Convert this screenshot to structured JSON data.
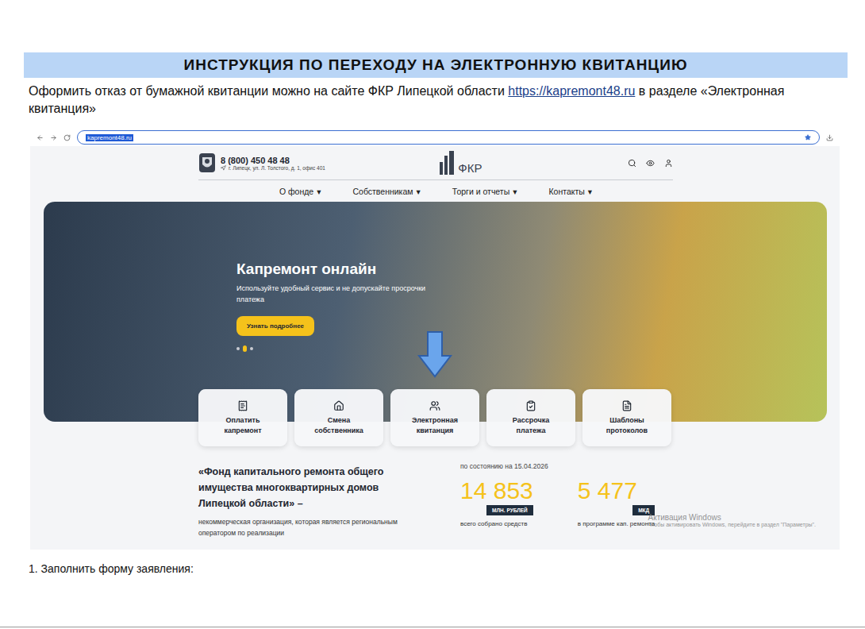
{
  "document": {
    "title": "ИНСТРУКЦИЯ ПО ПЕРЕХОДУ НА ЭЛЕКТРОННУЮ КВИТАНЦИЮ",
    "intro_before": "Оформить отказ от бумажной квитанции можно на сайте ФКР Липецкой области ",
    "intro_link": "https://kapremont48.ru",
    "intro_after": " в разделе «Электронная квитанция»",
    "step": "1. Заполнить форму заявления:"
  },
  "browser": {
    "url": "kapremont48.ru"
  },
  "site": {
    "phone": "8 (800) 450 48 48",
    "address": "г. Липецк, ул. Л. Толстого, д. 1, офис 401",
    "logo": "ФКР",
    "nav": [
      {
        "label": "О фонде",
        "symbol": "▾"
      },
      {
        "label": "Собственникам",
        "symbol": "▾"
      },
      {
        "label": "Торги и отчеты",
        "symbol": "▾"
      },
      {
        "label": "Контакты",
        "symbol": "▾"
      }
    ]
  },
  "hero": {
    "title": "Капремонт онлайн",
    "subtitle": "Используйте удобный сервис и не допускайте просрочки платежа",
    "button": "Узнать подробнее",
    "slides": [
      {
        "selected": false
      },
      {
        "selected": true
      },
      {
        "selected": false
      }
    ]
  },
  "cards": [
    {
      "label": "Оплатить капремонт",
      "pointed": false
    },
    {
      "label": "Смена собственника",
      "pointed": false
    },
    {
      "label": "Электронная квитанция",
      "pointed": true
    },
    {
      "label": "Рассрочка платежа",
      "pointed": false
    },
    {
      "label": "Шаблоны протоколов",
      "pointed": false
    }
  ],
  "about": {
    "title": "«Фонд капитального ремонта общего имущества многоквартирных домов Липецкой области» –",
    "text": "некоммерческая организация, которая является региональным оператором по реализации"
  },
  "stats": {
    "date": "по состоянию на 15.04.2026",
    "items": [
      {
        "value": "14 853",
        "unit": "МЛН. РУБЛЕЙ",
        "caption": "всего собрано средств"
      },
      {
        "value": "5 477",
        "unit": "МКД",
        "caption": "в программе кап. ремонта"
      }
    ]
  },
  "watermark": {
    "title": "Активация Windows",
    "text": "Чтобы активировать Windows, перейдите в раздел \"Параметры\"."
  }
}
